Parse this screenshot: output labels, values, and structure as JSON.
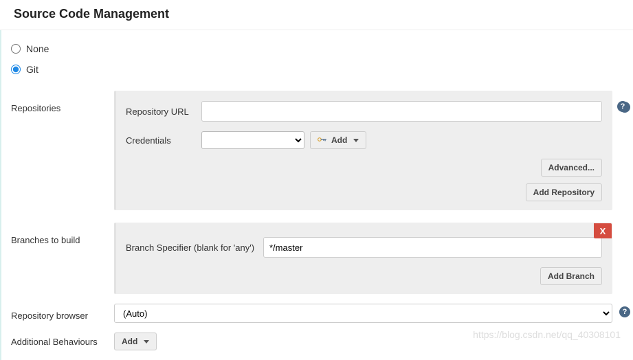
{
  "header": {
    "title": "Source Code Management"
  },
  "scm": {
    "options": {
      "none": "None",
      "git": "Git"
    },
    "selected": "git"
  },
  "repositories": {
    "section_label": "Repositories",
    "url_label": "Repository URL",
    "url_value": "",
    "credentials_label": "Credentials",
    "credentials_value": "",
    "add_cred_label": "Add",
    "advanced_label": "Advanced...",
    "add_repo_label": "Add Repository"
  },
  "branches": {
    "section_label": "Branches to build",
    "specifier_label": "Branch Specifier (blank for 'any')",
    "specifier_value": "*/master",
    "delete_label": "X",
    "add_branch_label": "Add Branch"
  },
  "browser": {
    "section_label": "Repository browser",
    "value": "(Auto)"
  },
  "behaviours": {
    "section_label": "Additional Behaviours",
    "add_label": "Add"
  },
  "watermark": "https://blog.csdn.net/qq_40308101"
}
